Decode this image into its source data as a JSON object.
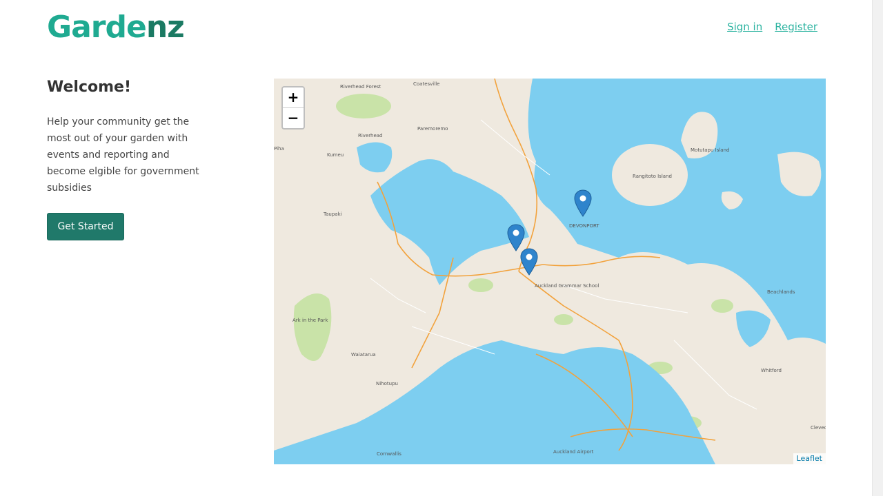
{
  "header": {
    "logo_part1": "Garde",
    "logo_part2": "nz",
    "nav": {
      "signin": "Sign in",
      "register": "Register"
    }
  },
  "main": {
    "heading": "Welcome!",
    "description": "Help your community get the most out of your garden with events and reporting and become elgible for government subsidies",
    "cta_label": "Get Started"
  },
  "map": {
    "zoom_in": "+",
    "zoom_out": "−",
    "attribution": "Leaflet",
    "marker_icon": "map-pin-icon",
    "colors": {
      "water": "#7dcef0",
      "land": "#efe9df",
      "park": "#c9e3a8",
      "road": "#f2a23c",
      "marker": "#2f84cc"
    },
    "place_labels": {
      "riverhead_forest": "Riverhead Forest",
      "coatesville": "Coatesville",
      "riverhead": "Riverhead",
      "paremoremo": "Paremoremo",
      "kumeu": "Kumeu",
      "taupaki": "Taupaki",
      "rangitoto": "Rangitoto Island",
      "motutapu": "Motutapu Island",
      "devonport": "DEVONPORT",
      "beachlands": "Beachlands",
      "whitford": "Whitford",
      "waiatarua": "Waiatarua",
      "nihotupu": "Nihotupu",
      "ark": "Ark in the Park",
      "grammar": "Auckland Grammar School",
      "airport": "Auckland Airport",
      "cornwallis": "Cornwallis",
      "piha": "Piha",
      "clevedon": "Cleved"
    }
  }
}
